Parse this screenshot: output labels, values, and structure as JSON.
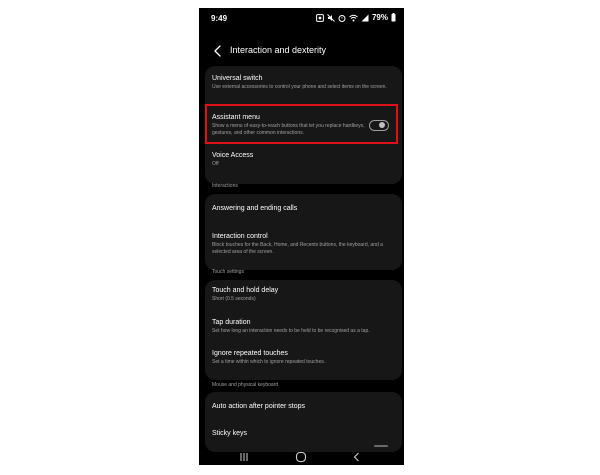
{
  "status_bar": {
    "time": "9:49",
    "battery": "79%",
    "icons": [
      "photo-icon",
      "mute-icon",
      "alarm-icon",
      "wifi-icon",
      "signal-icon",
      "battery-icon"
    ]
  },
  "header": {
    "title": "Interaction and dexterity",
    "back_icon": "chevron-left-icon"
  },
  "items": {
    "universal_switch": {
      "title": "Universal switch",
      "subtitle": "Use external accessories to control your phone and select items on the screen."
    },
    "assistant_menu": {
      "title": "Assistant menu",
      "subtitle": "Show a menu of easy-to-reach buttons that let you replace hardkeys, gestures, and other common interactions.",
      "toggle_on": false
    },
    "voice_access": {
      "title": "Voice Access",
      "subtitle": "Off"
    },
    "answering_calls": {
      "title": "Answering and ending calls"
    },
    "interaction_control": {
      "title": "Interaction control",
      "subtitle": "Block touches for the Back, Home, and Recents buttons, the keyboard, and a selected area of the screen."
    },
    "touch_hold_delay": {
      "title": "Touch and hold delay",
      "subtitle": "Short (0.5 seconds)"
    },
    "tap_duration": {
      "title": "Tap duration",
      "subtitle": "Set how long an interaction needs to be held to be recognised as a tap."
    },
    "ignore_repeated": {
      "title": "Ignore repeated touches",
      "subtitle": "Set a time within which to ignore repeated touches."
    },
    "auto_action": {
      "title": "Auto action after pointer stops"
    },
    "sticky_keys": {
      "title": "Sticky keys"
    }
  },
  "sections": {
    "interactions": "Interactions",
    "touch_settings": "Touch settings",
    "mouse_keyboard": "Mouse and physical keyboard"
  },
  "highlight_color": "#e0111b",
  "navbar": {
    "icons": [
      "recents-icon",
      "home-icon",
      "back-icon"
    ]
  }
}
